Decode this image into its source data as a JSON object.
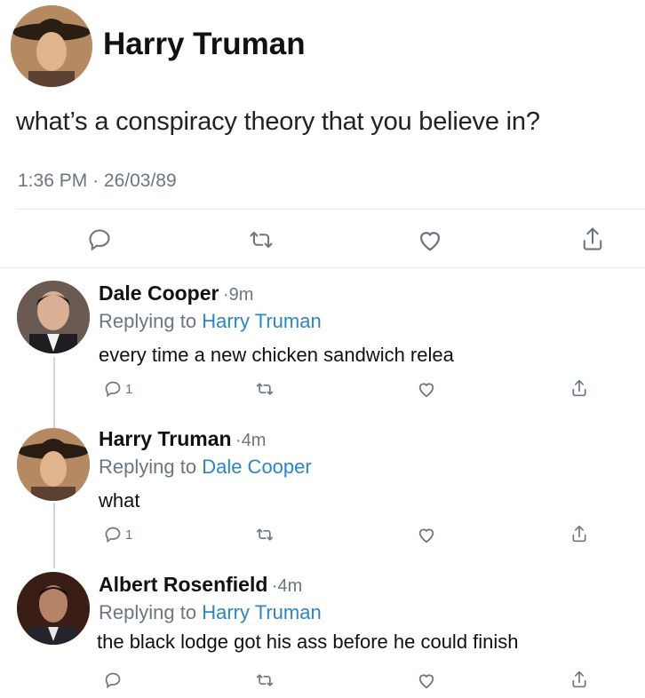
{
  "tweet": {
    "author": "Harry Truman",
    "text": "what’s a conspiracy theory that you believe in?",
    "time": "1:36 PM",
    "separator": "·",
    "date": "26/03/89",
    "actions": {
      "reply_icon": "reply-icon",
      "retweet_icon": "retweet-icon",
      "like_icon": "heart-icon",
      "share_icon": "share-icon"
    }
  },
  "replies": [
    {
      "author": "Dale Cooper",
      "time": "9m",
      "replying_label": "Replying to",
      "replying_to": "Harry Truman",
      "text": "every time a new chicken sandwich relea",
      "reply_count": "1"
    },
    {
      "author": "Harry Truman",
      "time": "4m",
      "replying_label": "Replying to",
      "replying_to": "Dale Cooper",
      "text": "what",
      "reply_count": "1"
    },
    {
      "author": "Albert Rosenfield",
      "time": "4m",
      "replying_label": "Replying to",
      "replying_to": "Harry Truman",
      "text": "the black lodge got his ass before he could finish",
      "reply_count": ""
    }
  ],
  "colors": {
    "link": "#2b86c5",
    "muted": "#6b7680",
    "divider": "#e6ecf0"
  }
}
